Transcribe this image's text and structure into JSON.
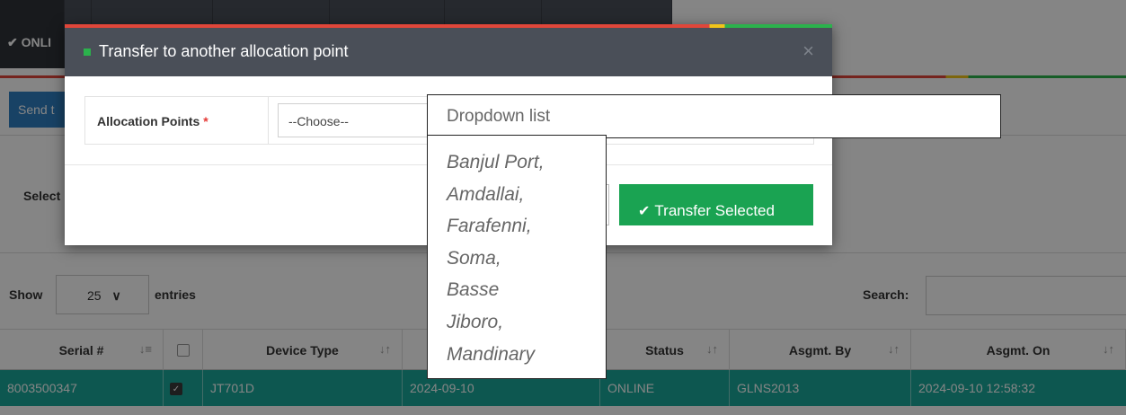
{
  "background": {
    "online_tab_label": "ONLI",
    "send_button_label": "Send t",
    "select_label": "Select",
    "show_label": "Show",
    "page_length": "25",
    "entries_label": "entries",
    "search_label": "Search:",
    "table": {
      "columns": [
        "Serial #",
        "",
        "Device Type",
        "",
        "Status",
        "Asgmt. By",
        "Asgmt. On"
      ],
      "rows": [
        {
          "serial": "8003500347",
          "checked": true,
          "device_type": "JT701D",
          "date": "2024-09-10",
          "status": "ONLINE",
          "asgmt_by": "GLNS2013",
          "asgmt_on": "2024-09-10 12:58:32"
        }
      ]
    }
  },
  "modal": {
    "title": "Transfer to another allocation point",
    "close_glyph": "×",
    "field_label": "Allocation Points",
    "required_mark": "*",
    "select_value": "--Choose--",
    "transfer_button_label": "Transfer Selected"
  },
  "annotation": {
    "header": "Dropdown list",
    "items": [
      "Banjul Port,",
      "Amdallai,",
      "Farafenni,",
      "Soma,",
      "Basse",
      "Jiboro,",
      "Mandinary"
    ]
  },
  "colors": {
    "header_bg": "#4a4f58",
    "accent_green": "#1aa352",
    "row_teal": "#1aa89a",
    "required_red": "#e53935"
  }
}
